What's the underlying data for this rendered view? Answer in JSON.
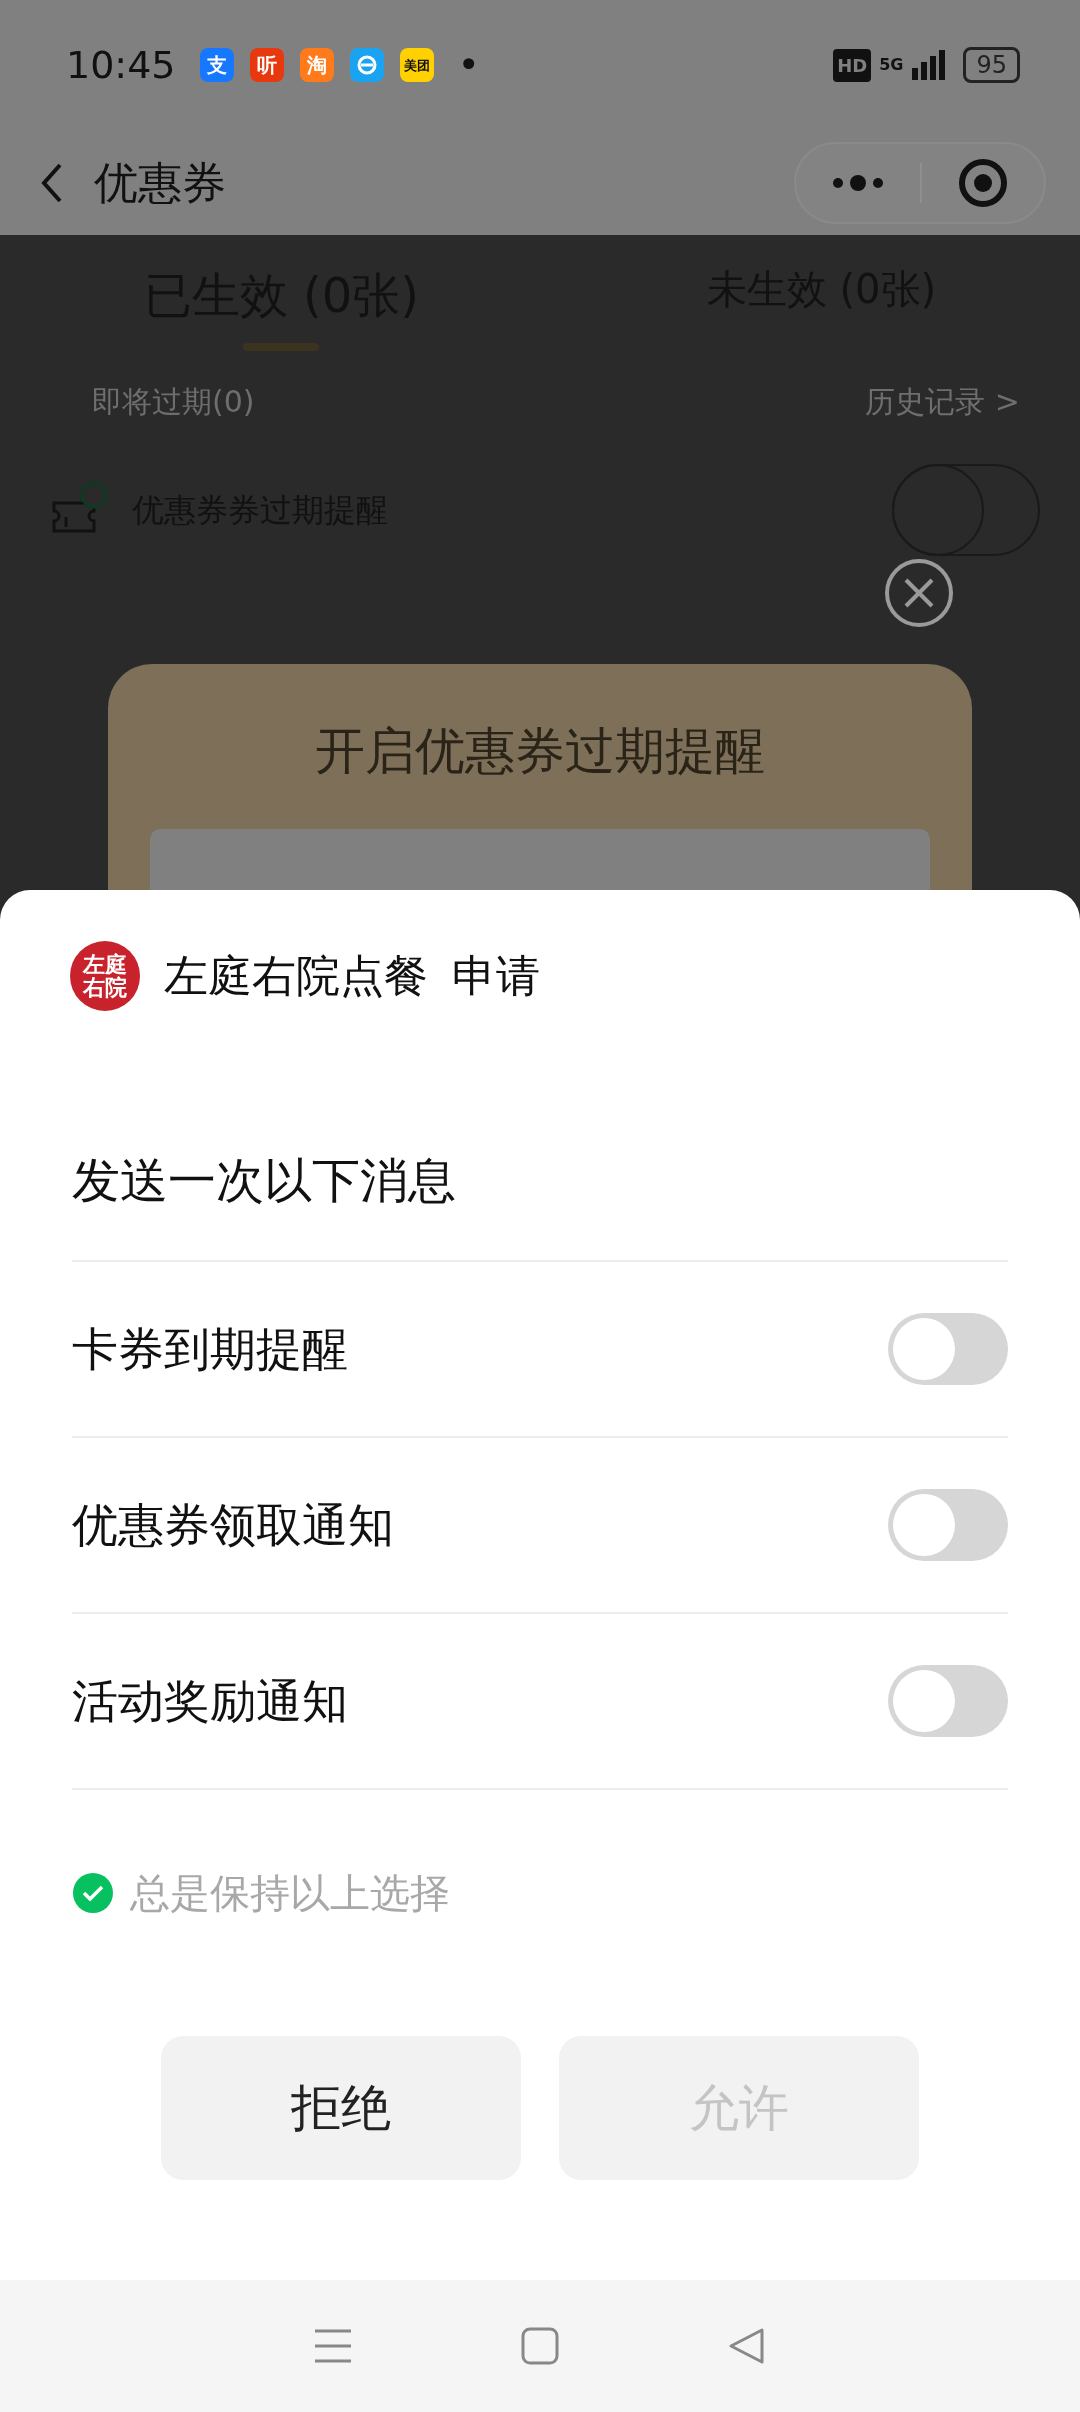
{
  "status_bar": {
    "time": "10:45",
    "notifications": [
      {
        "kind": "text",
        "label": "支",
        "color": "#1677ff"
      },
      {
        "kind": "text",
        "label": "听",
        "color": "#e8380d"
      },
      {
        "kind": "text",
        "label": "淘",
        "color": "#ff7a1a"
      },
      {
        "kind": "drawing",
        "color": "#1aa3f0"
      },
      {
        "kind": "text",
        "label": "美团",
        "color": "#ffd100"
      }
    ],
    "more": "•",
    "hd": "HD",
    "network": "5G",
    "battery": "95"
  },
  "header": {
    "title": "优惠券"
  },
  "tabs": [
    {
      "label": "已生效 (0张)",
      "selected": true
    },
    {
      "label": "未生效 (0张)",
      "selected": false
    }
  ],
  "expiring": "即将过期(0)",
  "history_link": "历史记录 >",
  "reminder": {
    "label": "优惠券券过期提醒",
    "on": false
  },
  "promo": {
    "title": "开启优惠券过期提醒"
  },
  "sheet": {
    "logo_lines": [
      "左庭",
      "右院"
    ],
    "app_name": "左庭右院点餐",
    "action": "申请",
    "subtitle": "发送一次以下消息",
    "options": [
      {
        "label": "卡券到期提醒",
        "on": false
      },
      {
        "label": "优惠券领取通知",
        "on": false
      },
      {
        "label": "活动奖励通知",
        "on": false
      }
    ],
    "remember": {
      "label": "总是保持以上选择",
      "checked": true
    },
    "buttons": [
      {
        "label": "拒绝",
        "disabled": false
      },
      {
        "label": "允许",
        "disabled": true
      }
    ]
  }
}
